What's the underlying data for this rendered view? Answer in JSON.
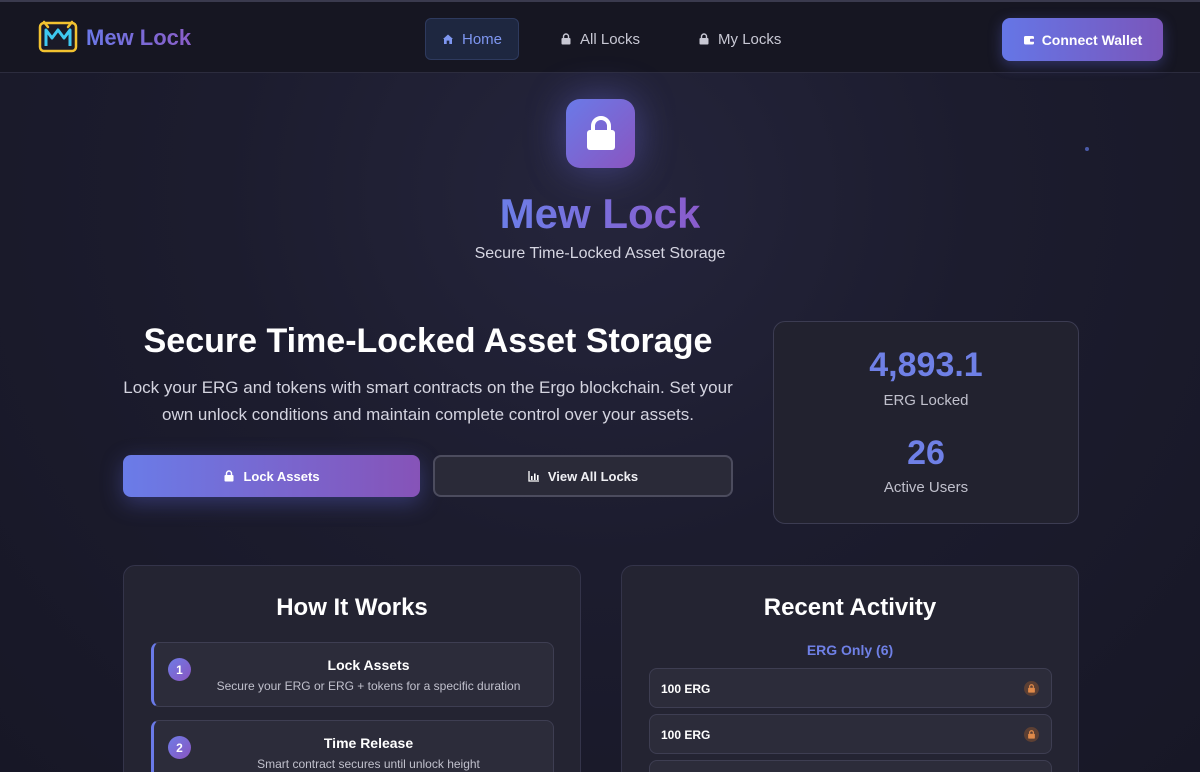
{
  "brand": {
    "name": "Mew Lock"
  },
  "nav": {
    "items": [
      {
        "label": "Home",
        "icon": "home-icon",
        "active": true
      },
      {
        "label": "All Locks",
        "icon": "lock-icon",
        "active": false
      },
      {
        "label": "My Locks",
        "icon": "lock-icon",
        "active": false
      }
    ],
    "connect_label": "Connect Wallet"
  },
  "hero": {
    "title": "Mew Lock",
    "subtitle": "Secure Time-Locked Asset Storage"
  },
  "intro": {
    "title": "Secure Time-Locked Asset Storage",
    "description": "Lock your ERG and tokens with smart contracts on the Ergo blockchain. Set your own unlock conditions and maintain complete control over your assets.",
    "lock_button": "Lock Assets",
    "view_button": "View All Locks"
  },
  "stats": [
    {
      "value": "4,893.1",
      "label": "ERG Locked"
    },
    {
      "value": "26",
      "label": "Active Users"
    }
  ],
  "how_it_works": {
    "title": "How It Works",
    "steps": [
      {
        "number": "1",
        "title": "Lock Assets",
        "description": "Secure your ERG or ERG + tokens for a specific duration"
      },
      {
        "number": "2",
        "title": "Time Release",
        "description": "Smart contract secures until unlock height"
      }
    ]
  },
  "recent_activity": {
    "title": "Recent Activity",
    "filter_label": "ERG Only (6)",
    "items": [
      {
        "amount": "100 ERG"
      },
      {
        "amount": "100 ERG"
      },
      {
        "amount": ""
      }
    ]
  },
  "colors": {
    "accent": "#6f80e6",
    "accent_purple": "#8a55c0",
    "background": "#1c1c2e",
    "lock_badge": "#e08a4a"
  }
}
